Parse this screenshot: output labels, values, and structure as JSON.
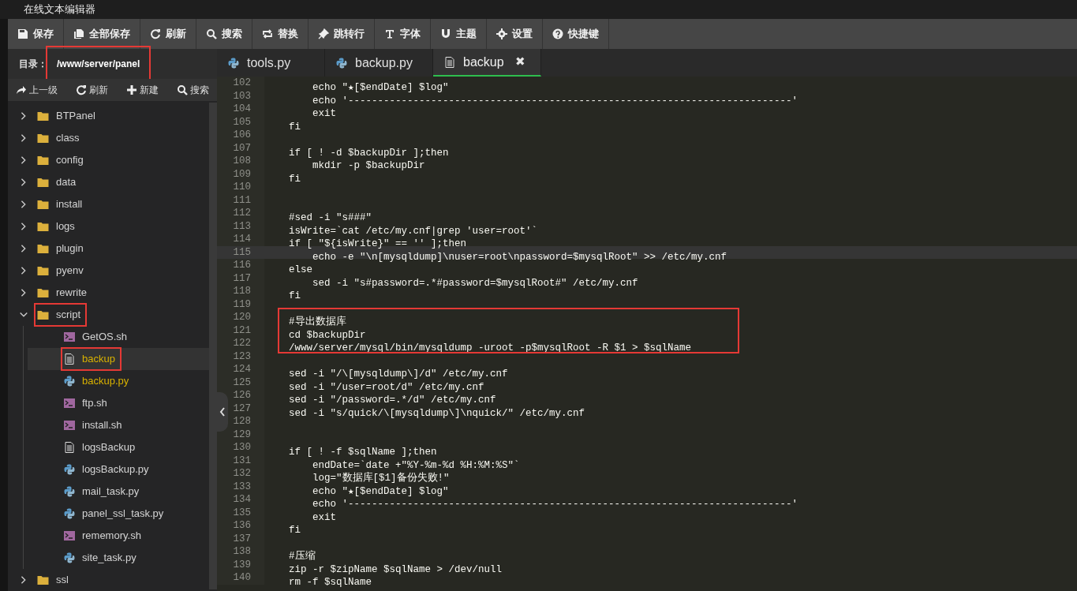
{
  "window": {
    "title": "在线文本编辑器"
  },
  "toolbar": [
    {
      "label": "保存"
    },
    {
      "label": "全部保存"
    },
    {
      "label": "刷新"
    },
    {
      "label": "搜索"
    },
    {
      "label": "替换"
    },
    {
      "label": "跳转行"
    },
    {
      "label": "字体"
    },
    {
      "label": "主题"
    },
    {
      "label": "设置"
    },
    {
      "label": "快捷键"
    }
  ],
  "sidebar": {
    "directory_label": "目录：",
    "directory_path": "/www/server/panel",
    "path_annotated": true,
    "actions": [
      {
        "label": "上一级"
      },
      {
        "label": "刷新"
      },
      {
        "label": "新建"
      },
      {
        "label": "搜索"
      }
    ],
    "tree": [
      {
        "kind": "folder",
        "name": "BTPanel",
        "expanded": false,
        "selected": false,
        "open": false,
        "annotated": false
      },
      {
        "kind": "folder",
        "name": "class",
        "expanded": false,
        "selected": false,
        "open": false,
        "annotated": false
      },
      {
        "kind": "folder",
        "name": "config",
        "expanded": false,
        "selected": false,
        "open": false,
        "annotated": false
      },
      {
        "kind": "folder",
        "name": "data",
        "expanded": false,
        "selected": false,
        "open": false,
        "annotated": false
      },
      {
        "kind": "folder",
        "name": "install",
        "expanded": false,
        "selected": false,
        "open": false,
        "annotated": false
      },
      {
        "kind": "folder",
        "name": "logs",
        "expanded": false,
        "selected": false,
        "open": false,
        "annotated": false
      },
      {
        "kind": "folder",
        "name": "plugin",
        "expanded": false,
        "selected": false,
        "open": false,
        "annotated": false
      },
      {
        "kind": "folder",
        "name": "pyenv",
        "expanded": false,
        "selected": false,
        "open": false,
        "annotated": false
      },
      {
        "kind": "folder",
        "name": "rewrite",
        "expanded": false,
        "selected": false,
        "open": false,
        "annotated": false
      },
      {
        "kind": "folder",
        "name": "script",
        "expanded": true,
        "selected": false,
        "open": false,
        "annotated": true,
        "children": [
          {
            "kind": "shell",
            "name": "GetOS.sh",
            "selected": false,
            "open": false,
            "annotated": false
          },
          {
            "kind": "text",
            "name": "backup",
            "selected": true,
            "open": true,
            "annotated": true
          },
          {
            "kind": "python",
            "name": "backup.py",
            "selected": false,
            "open": true,
            "annotated": false
          },
          {
            "kind": "shell",
            "name": "ftp.sh",
            "selected": false,
            "open": false,
            "annotated": false
          },
          {
            "kind": "shell",
            "name": "install.sh",
            "selected": false,
            "open": false,
            "annotated": false
          },
          {
            "kind": "text",
            "name": "logsBackup",
            "selected": false,
            "open": false,
            "annotated": false
          },
          {
            "kind": "python",
            "name": "logsBackup.py",
            "selected": false,
            "open": false,
            "annotated": false
          },
          {
            "kind": "python",
            "name": "mail_task.py",
            "selected": false,
            "open": false,
            "annotated": false
          },
          {
            "kind": "python",
            "name": "panel_ssl_task.py",
            "selected": false,
            "open": false,
            "annotated": false
          },
          {
            "kind": "shell",
            "name": "rememory.sh",
            "selected": false,
            "open": false,
            "annotated": false
          },
          {
            "kind": "python",
            "name": "site_task.py",
            "selected": false,
            "open": false,
            "annotated": false
          }
        ]
      },
      {
        "kind": "folder",
        "name": "ssl",
        "expanded": false,
        "selected": false,
        "open": false,
        "annotated": false
      }
    ]
  },
  "tabs": [
    {
      "kind": "python",
      "label": "tools.py",
      "selected": false
    },
    {
      "kind": "python",
      "label": "backup.py",
      "selected": false
    },
    {
      "kind": "text",
      "label": "backup",
      "selected": true,
      "close": "✖"
    }
  ],
  "editor": {
    "lines": [
      {
        "number": "102",
        "text": "    echo \"★[$endDate] $log\"",
        "current": false,
        "boxed": false
      },
      {
        "number": "103",
        "text": "    echo '---------------------------------------------------------------------------'",
        "current": false,
        "boxed": false
      },
      {
        "number": "104",
        "text": "    exit",
        "current": false,
        "boxed": false
      },
      {
        "number": "105",
        "text": "fi",
        "current": false,
        "boxed": false
      },
      {
        "number": "106",
        "current": false,
        "boxed": false
      },
      {
        "number": "107",
        "text": "if [ ! -d $backupDir ];then",
        "current": false,
        "boxed": false
      },
      {
        "number": "108",
        "text": "    mkdir -p $backupDir",
        "current": false,
        "boxed": false
      },
      {
        "number": "109",
        "text": "fi",
        "current": false,
        "boxed": false
      },
      {
        "number": "110",
        "current": false,
        "boxed": false
      },
      {
        "number": "111",
        "current": false,
        "boxed": false
      },
      {
        "number": "112",
        "text": "#sed -i \"s###\"",
        "current": false,
        "boxed": false
      },
      {
        "number": "113",
        "text": "isWrite=`cat /etc/my.cnf|grep 'user=root'`",
        "current": false,
        "boxed": false
      },
      {
        "number": "114",
        "text": "if [ \"${isWrite}\" == '' ];then",
        "current": false,
        "boxed": false
      },
      {
        "number": "115",
        "text": "    echo -e \"\\n[mysqldump]\\nuser=root\\npassword=$mysqlRoot\" >> /etc/my.cnf",
        "current": true,
        "boxed": false
      },
      {
        "number": "116",
        "text": "else",
        "current": false,
        "boxed": false
      },
      {
        "number": "117",
        "text": "    sed -i \"s#password=.*#password=$mysqlRoot#\" /etc/my.cnf",
        "current": false,
        "boxed": false
      },
      {
        "number": "118",
        "text": "fi",
        "current": false,
        "boxed": false
      },
      {
        "number": "119",
        "current": false,
        "boxed": false
      },
      {
        "number": "120",
        "text": "#导出数据库",
        "current": false,
        "boxed": true
      },
      {
        "number": "121",
        "text": "cd $backupDir",
        "current": false,
        "boxed": true
      },
      {
        "number": "122",
        "text": "/www/server/mysql/bin/mysqldump -uroot -p$mysqlRoot -R $1 > $sqlName",
        "current": false,
        "boxed": true
      },
      {
        "number": "123",
        "current": false,
        "boxed": false
      },
      {
        "number": "124",
        "text": "sed -i \"/\\[mysqldump\\]/d\" /etc/my.cnf",
        "current": false,
        "boxed": false
      },
      {
        "number": "125",
        "text": "sed -i \"/user=root/d\" /etc/my.cnf",
        "current": false,
        "boxed": false
      },
      {
        "number": "126",
        "text": "sed -i \"/password=.*/d\" /etc/my.cnf",
        "current": false,
        "boxed": false
      },
      {
        "number": "127",
        "text": "sed -i \"s/quick/\\[mysqldump\\]\\nquick/\" /etc/my.cnf",
        "current": false,
        "boxed": false
      },
      {
        "number": "128",
        "current": false,
        "boxed": false
      },
      {
        "number": "129",
        "current": false,
        "boxed": false
      },
      {
        "number": "130",
        "text": "if [ ! -f $sqlName ];then",
        "current": false,
        "boxed": false
      },
      {
        "number": "131",
        "text": "    endDate=`date +\"%Y-%m-%d %H:%M:%S\"`",
        "current": false,
        "boxed": false
      },
      {
        "number": "132",
        "text": "    log=\"数据库[$1]备份失败!\"",
        "current": false,
        "boxed": false
      },
      {
        "number": "133",
        "text": "    echo \"★[$endDate] $log\"",
        "current": false,
        "boxed": false
      },
      {
        "number": "134",
        "text": "    echo '---------------------------------------------------------------------------'",
        "current": false,
        "boxed": false
      },
      {
        "number": "135",
        "text": "    exit",
        "current": false,
        "boxed": false
      },
      {
        "number": "136",
        "text": "fi",
        "current": false,
        "boxed": false
      },
      {
        "number": "137",
        "current": false,
        "boxed": false
      },
      {
        "number": "138",
        "text": "#压缩",
        "current": false,
        "boxed": false
      },
      {
        "number": "139",
        "text": "zip -r $zipName $sqlName > /dev/null",
        "current": false,
        "boxed": false
      },
      {
        "number": "140",
        "text": "rm -f $sqlName",
        "current": false,
        "boxed": false
      }
    ]
  }
}
